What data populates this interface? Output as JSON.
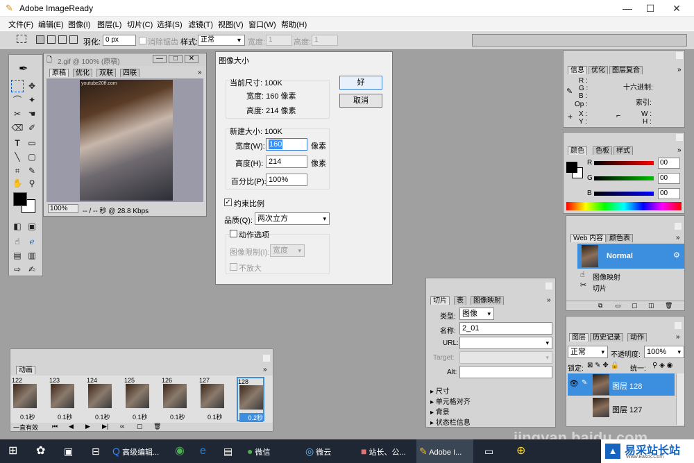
{
  "window": {
    "title": "Adobe ImageReady",
    "minimize": "—",
    "maximize": "☐",
    "close": "✕"
  },
  "menu": [
    "文件(F)",
    "编辑(E)",
    "图像(I)",
    "图层(L)",
    "切片(C)",
    "选择(S)",
    "滤镜(T)",
    "视图(V)",
    "窗口(W)",
    "帮助(H)"
  ],
  "options": {
    "feather_label": "羽化:",
    "feather_value": "0 px",
    "antialias_label": "消除锯齿",
    "style_label": "样式:",
    "style_value": "正常",
    "width_label": "宽度:",
    "width_value": "1",
    "height_label": "高度:",
    "height_value": "1"
  },
  "document": {
    "title": "2.gif @ 100% (原稿)",
    "tabs": [
      "原稿",
      "优化",
      "双联",
      "四联"
    ],
    "watermark": "youtube20ff.com",
    "zoom": "100%",
    "status": "-- / -- 秒 @ 28.8 Kbps"
  },
  "dialog": {
    "title": "图像大小",
    "current_label": "当前尺寸: 100K",
    "current_width_label": "宽度: 160 像素",
    "current_height_label": "高度: 214 像素",
    "ok": "好",
    "cancel": "取消",
    "new_label": "新建大小: 100K",
    "width_label": "宽度(W):",
    "width_value": "160",
    "width_unit": "像素",
    "height_label": "高度(H):",
    "height_value": "214",
    "height_unit": "像素",
    "percent_label": "百分比(P):",
    "percent_value": "100%",
    "constrain_label": "约束比例",
    "quality_label": "品质(Q):",
    "quality_value": "两次立方",
    "action_label": "动作选项",
    "fit_label": "图像限制(I):",
    "fit_value": "宽度",
    "no_enlarge_label": "不放大"
  },
  "info_panel": {
    "tabs": [
      "信息",
      "优化",
      "图层复合"
    ],
    "r": "R :",
    "g": "G :",
    "b": "B :",
    "op": "Op :",
    "hex": "十六进制:",
    "index": "索引:",
    "x": "X :",
    "y": "Y :",
    "w": "W :",
    "h": "H :"
  },
  "color_panel": {
    "tabs": [
      "颜色",
      "色板",
      "样式"
    ],
    "channels": [
      {
        "label": "R",
        "value": "00",
        "color": "#ff0000"
      },
      {
        "label": "G",
        "value": "00",
        "color": "#00c000"
      },
      {
        "label": "B",
        "value": "00",
        "color": "#0000ff"
      }
    ]
  },
  "web_panel": {
    "tabs": [
      "Web 内容",
      "颜色表"
    ],
    "row_normal": "Normal",
    "row_imagemap": "图像映射",
    "row_slice": "切片"
  },
  "slice_panel": {
    "tabs": [
      "切片",
      "表",
      "图像映射"
    ],
    "type_label": "类型:",
    "type_value": "图像",
    "name_label": "名称:",
    "name_value": "2_01",
    "url_label": "URL:",
    "target_label": "Target:",
    "alt_label": "Alt:",
    "sections": [
      "尺寸",
      "单元格对齐",
      "背景",
      "状态栏信息"
    ]
  },
  "layers_panel": {
    "tabs": [
      "图层",
      "历史记录",
      "动作"
    ],
    "blend": "正常",
    "opacity_label": "不透明度:",
    "opacity_value": "100%",
    "lock_label": "锁定:",
    "unify_label": "统一:",
    "layer_selected": "图层 128",
    "layer_next": "图层 127"
  },
  "animation_panel": {
    "tab": "动画",
    "frames": [
      {
        "num": "122",
        "time": "0.1秒"
      },
      {
        "num": "123",
        "time": "0.1秒"
      },
      {
        "num": "124",
        "time": "0.1秒"
      },
      {
        "num": "125",
        "time": "0.1秒"
      },
      {
        "num": "126",
        "time": "0.1秒"
      },
      {
        "num": "127",
        "time": "0.1秒"
      },
      {
        "num": "128",
        "time": "0.2秒"
      }
    ],
    "loop": "一直有效"
  },
  "taskbar": {
    "items": [
      "高级编辑...",
      "微信",
      "微云",
      "站长、公...",
      "Adobe I..."
    ],
    "brand": "易采站长站",
    "brand_sub": "Www.Easck.Com",
    "watermark": "jingyan.baidu.com"
  }
}
